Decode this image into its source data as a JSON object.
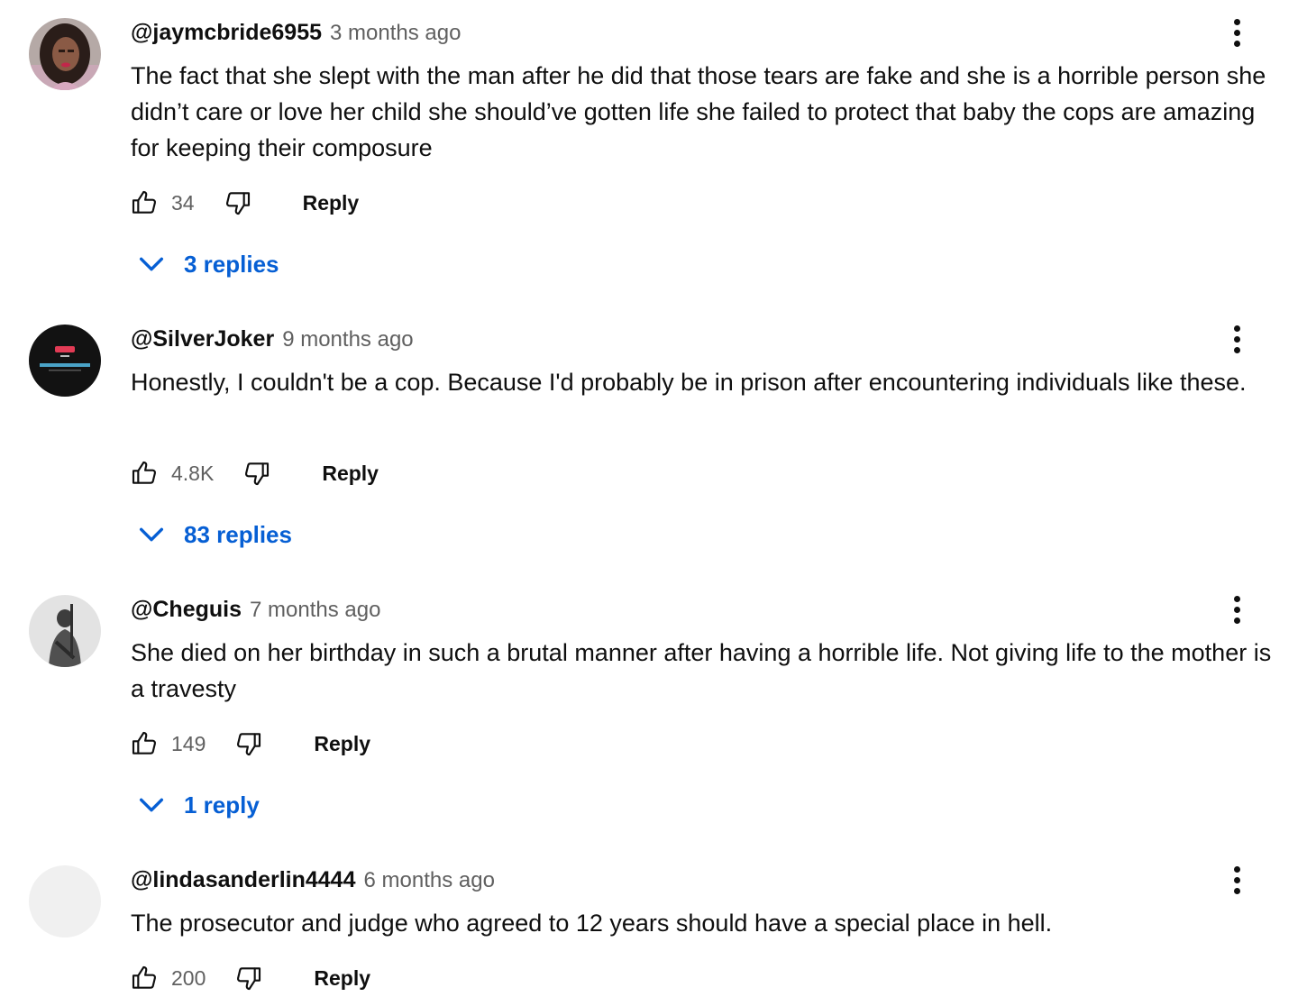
{
  "comments": [
    {
      "author": "@jaymcbride6955",
      "time": "3 months ago",
      "text": "The fact that she slept with the man after he did that those tears are fake and she is a horrible person she didn’t care or love her child she should’ve gotten life she failed to protect that baby the cops are amazing for keeping their composure",
      "likes": "34",
      "reply_label": "Reply",
      "replies_label": "3 replies",
      "avatar_icon": "person-photo-avatar"
    },
    {
      "author": "@SilverJoker",
      "time": "9 months ago",
      "text": "Honestly, I couldn't be a cop. Because I'd probably be in prison after encountering individuals like these.",
      "likes": "4.8K",
      "reply_label": "Reply",
      "replies_label": "83 replies",
      "avatar_icon": "silver-joker-logo-avatar",
      "avatar_text": "THE SILVER JOKER"
    },
    {
      "author": "@Cheguis",
      "time": "7 months ago",
      "text": "She died on her birthday in such a brutal manner after having a horrible life. Not giving life to the mother is a travesty",
      "likes": "149",
      "reply_label": "Reply",
      "replies_label": "1 reply",
      "avatar_icon": "statue-avatar"
    },
    {
      "author": "@lindasanderlin4444",
      "time": "6 months ago",
      "text": "The prosecutor and judge who agreed to 12 years should have a special place in hell.",
      "likes": "200",
      "reply_label": "Reply",
      "avatar_icon": "blank-avatar"
    }
  ],
  "icons": {
    "like": "thumbs-up-icon",
    "dislike": "thumbs-down-icon",
    "more": "more-vertical-icon",
    "expand": "chevron-down-icon"
  },
  "colors": {
    "link_blue": "#065fd4",
    "text": "#0f0f0f",
    "secondary_text": "#606060"
  }
}
